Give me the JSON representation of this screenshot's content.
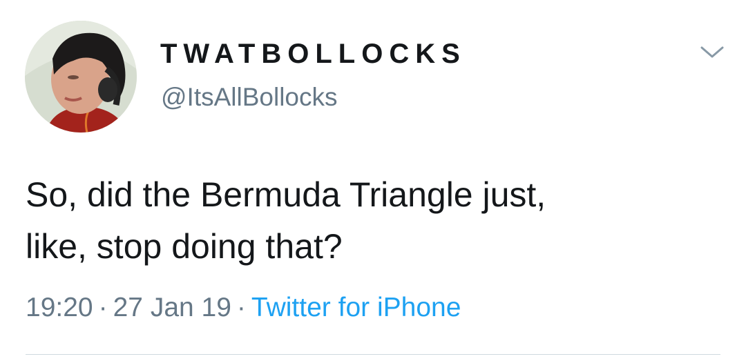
{
  "tweet": {
    "author": {
      "display_name": "TWATBOLLOCKS",
      "handle": "@ItsAllBollocks",
      "avatar_icon": "profile-photo"
    },
    "menu_icon": "chevron-down-icon",
    "text_line1": "So, did the Bermuda Triangle just,",
    "text_line2": "like, stop doing that?",
    "time": "19:20",
    "separator": "·",
    "date": "27 Jan 19",
    "source": "Twitter for iPhone",
    "colors": {
      "text": "#14171a",
      "secondary": "#657786",
      "link": "#1da1f2",
      "divider": "#cfd9de"
    }
  }
}
